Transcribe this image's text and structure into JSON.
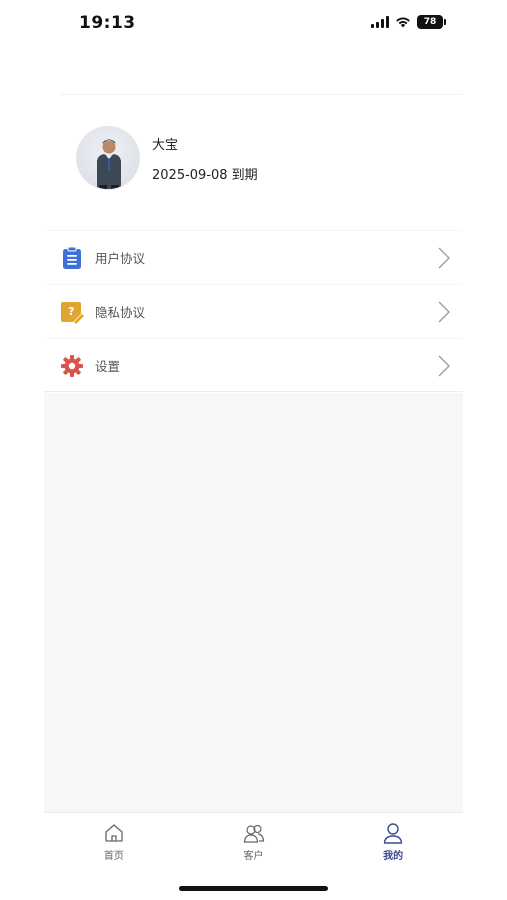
{
  "status_bar": {
    "time": "19:13",
    "battery": "78",
    "icons": [
      "signal-icon",
      "wifi-icon",
      "battery-icon"
    ]
  },
  "profile": {
    "name": "大宝",
    "expiry": "2025-09-08 到期"
  },
  "menu": {
    "items": [
      {
        "label": "用户协议",
        "icon": "clipboard-icon",
        "color": "#3f6fd8"
      },
      {
        "label": "隐私协议",
        "icon": "question-note-icon",
        "color": "#e0a531"
      },
      {
        "label": "设置",
        "icon": "gear-icon",
        "color": "#d9534f"
      }
    ]
  },
  "tabbar": {
    "tabs": [
      {
        "label": "首页",
        "icon": "home-icon"
      },
      {
        "label": "客户",
        "icon": "users-icon"
      },
      {
        "label": "我的",
        "icon": "user-icon",
        "active": true
      }
    ]
  },
  "colors": {
    "accent": "#3a4a8f",
    "background": "#f7f7f7"
  }
}
